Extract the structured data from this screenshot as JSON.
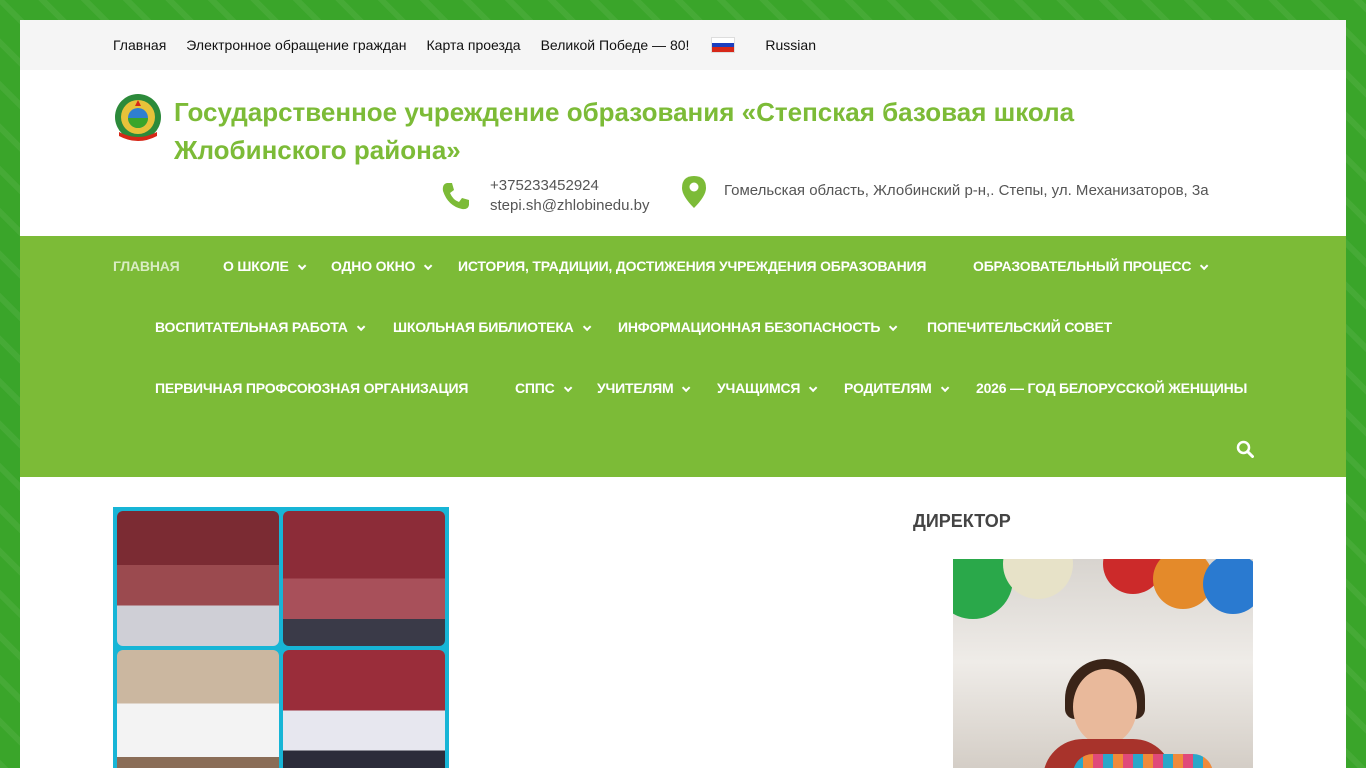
{
  "topbar": {
    "links": [
      "Главная",
      "Электронное обращение граждан",
      "Карта проезда",
      "Великой Победе — 80!"
    ],
    "language": "Russian"
  },
  "header": {
    "title": "Государственное учреждение образования «Степская базовая школа Жлобинского района»",
    "phone": "+375233452924",
    "email": "stepi.sh@zhlobinedu.by",
    "address": "Гомельская область, Жлобинский р-н,. Степы, ул. Механизаторов, 3а"
  },
  "nav": {
    "items": [
      "Главная",
      "О школе",
      "Одно окно",
      "История, традиции, достижения учреждения образования",
      "Образовательный процесс",
      "Воспитательная работа",
      "Школьная библиотека",
      "Информационная безопасность",
      "Попечительский совет",
      "Первичная профсоюзная организация",
      "СППС",
      "Учителям",
      "Учащимся",
      "Родителям",
      "2026 — Год белорусской женщины"
    ]
  },
  "sidebar": {
    "title": "Директор"
  },
  "colors": {
    "accent": "#7cbb37",
    "background": "#3aa52a"
  }
}
